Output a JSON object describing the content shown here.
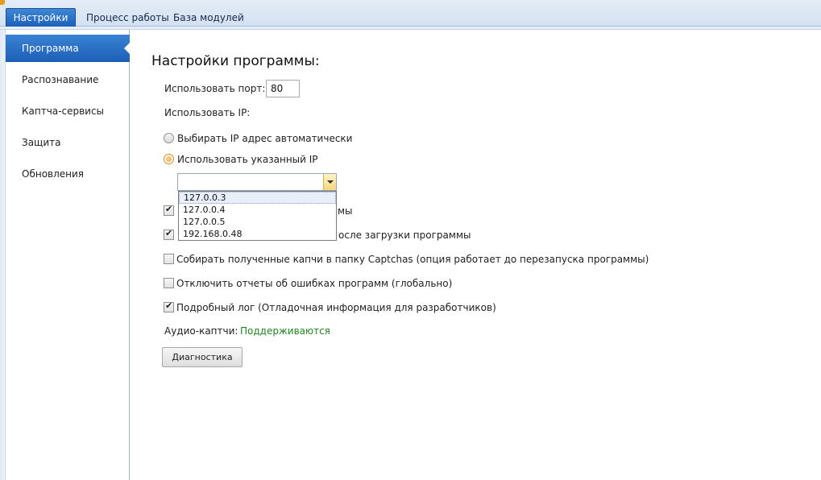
{
  "tabs": [
    {
      "label": "Настройки",
      "active": true
    },
    {
      "label": "Процесс работы",
      "active": false
    },
    {
      "label": "База модулей",
      "active": false
    }
  ],
  "sidebar": {
    "items": [
      {
        "label": "Программа",
        "active": true
      },
      {
        "label": "Распознавание",
        "active": false
      },
      {
        "label": "Каптча-сервисы",
        "active": false
      },
      {
        "label": "Защита",
        "active": false
      },
      {
        "label": "Обновления",
        "active": false
      }
    ]
  },
  "main": {
    "title": "Настройки программы:",
    "port_label": "Использовать порт:",
    "port_value": "80",
    "ip_label": "Использовать IP:",
    "radio_auto": {
      "label": "Выбирать IP адрес автоматически",
      "checked": false
    },
    "radio_manual": {
      "label": "Использовать указанный IP",
      "checked": true
    },
    "ip_combo_value": "",
    "ip_options": [
      "127.0.0.3",
      "127.0.0.4",
      "127.0.0.5",
      "192.168.0.48"
    ],
    "checkboxes": [
      {
        "label": "мы",
        "checked": true
      },
      {
        "label": "осле загрузки программы",
        "checked": true
      },
      {
        "label": "Собирать полученные капчи в папку Captchas (опция работает до перезапуска программы)",
        "checked": false
      },
      {
        "label": "Отключить отчеты об ошибках программ (глобально)",
        "checked": false
      },
      {
        "label": "Подробный лог (Отладочная информация для разработчиков)",
        "checked": true
      }
    ],
    "audio_label": "Аудио-каптчи:",
    "audio_value": "Поддерживаются",
    "diag_button": "Диагностика"
  },
  "colors": {
    "accent": "#1c5fb7",
    "status_ok": "#1e8a1e"
  }
}
